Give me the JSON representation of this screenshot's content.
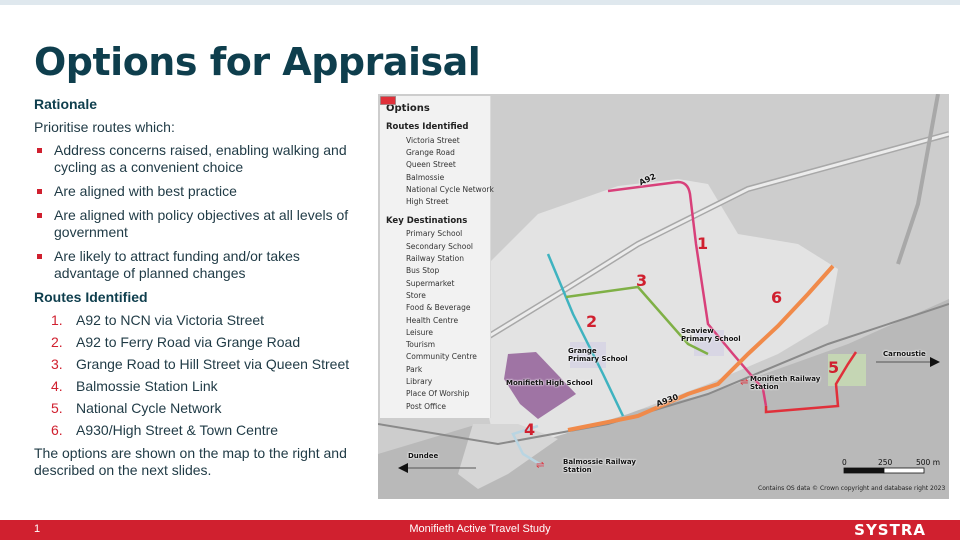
{
  "slide": {
    "title": "Options for Appraisal",
    "page_number": "1",
    "footer_text": "Monifieth Active Travel Study",
    "logo": "SYSTRA",
    "colors": {
      "title": "#0e3e4d",
      "accent": "#d0202f"
    }
  },
  "rationale": {
    "heading": "Rationale",
    "intro": "Prioritise routes which:",
    "bullets": [
      "Address concerns raised, enabling walking and cycling as a convenient choice",
      "Are aligned with best practice",
      "Are aligned with policy objectives at all levels of government",
      "Are likely to attract funding and/or takes advantage of planned changes"
    ]
  },
  "routes": {
    "heading": "Routes Identified",
    "items": [
      {
        "num": "1.",
        "label": "A92 to NCN via Victoria Street"
      },
      {
        "num": "2.",
        "label": "A92 to Ferry Road via Grange Road"
      },
      {
        "num": "3.",
        "label": "Grange Road to Hill Street via Queen Street"
      },
      {
        "num": "4.",
        "label": "Balmossie Station Link"
      },
      {
        "num": "5.",
        "label": "National Cycle Network"
      },
      {
        "num": "6.",
        "label": "A930/High Street & Town Centre"
      }
    ],
    "closing": "The options are shown on the map to the right and described on the next slides."
  },
  "map": {
    "legend": {
      "title": "Options",
      "routes_heading": "Routes Identified",
      "routes": [
        {
          "label": "Victoria Street",
          "color": "#d8407a"
        },
        {
          "label": "Grange Road",
          "color": "#3fb3c0"
        },
        {
          "label": "Queen Street",
          "color": "#7fb046"
        },
        {
          "label": "Balmossie",
          "color": "#b9d5e2"
        },
        {
          "label": "National Cycle Network",
          "color": "#e0303a"
        },
        {
          "label": "High Street",
          "color": "#f08a4a"
        }
      ],
      "destinations_heading": "Key Destinations",
      "destinations": [
        {
          "label": "Primary School",
          "symbol": "box",
          "color": "#e3e0ea"
        },
        {
          "label": "Secondary School",
          "symbol": "box",
          "color": "#a67aa8"
        },
        {
          "label": "Railway Station",
          "symbol": "rail",
          "color": "#e0303a"
        },
        {
          "label": "Bus Stop",
          "symbol": "dot",
          "color": "#333333"
        },
        {
          "label": "Supermarket",
          "symbol": "diamond",
          "color": "#c04a7a"
        },
        {
          "label": "Store",
          "symbol": "dot",
          "color": "#c04a7a"
        },
        {
          "label": "Food & Beverage",
          "symbol": "dot",
          "color": "#2b3f8a"
        },
        {
          "label": "Health Centre",
          "symbol": "health",
          "color": "#e0303a"
        },
        {
          "label": "Leisure",
          "symbol": "ring",
          "color": "#3aa06a"
        },
        {
          "label": "Tourism",
          "symbol": "triangle",
          "color": "#999999"
        },
        {
          "label": "Community Centre",
          "symbol": "dot",
          "color": "#4a3a30"
        },
        {
          "label": "Park",
          "symbol": "box",
          "color": "#c5d6b4"
        },
        {
          "label": "Library",
          "symbol": "box",
          "color": "#3fb3c0"
        },
        {
          "label": "Place Of Worship",
          "symbol": "box",
          "color": "#fbead0"
        },
        {
          "label": "Post Office",
          "symbol": "box",
          "color": "#e0303a"
        }
      ]
    },
    "labels": {
      "a92": "A92",
      "a930": "A930",
      "grange_school": "Grange\nPrimary School",
      "seaview_school": "Seaview\nPrimary School",
      "monifieth_high": "Monifieth High School",
      "monifieth_station": "Monifieth Railway\nStation",
      "balmossie_station": "Balmossie Railway\nStation",
      "carnoustie": "Carnoustie",
      "dundee": "Dundee"
    },
    "route_numbers": [
      "1",
      "2",
      "3",
      "4",
      "5",
      "6"
    ],
    "scale": {
      "ticks": [
        "0",
        "250",
        "500 m"
      ]
    },
    "credit": "Contains OS data © Crown copyright and database right 2023"
  }
}
